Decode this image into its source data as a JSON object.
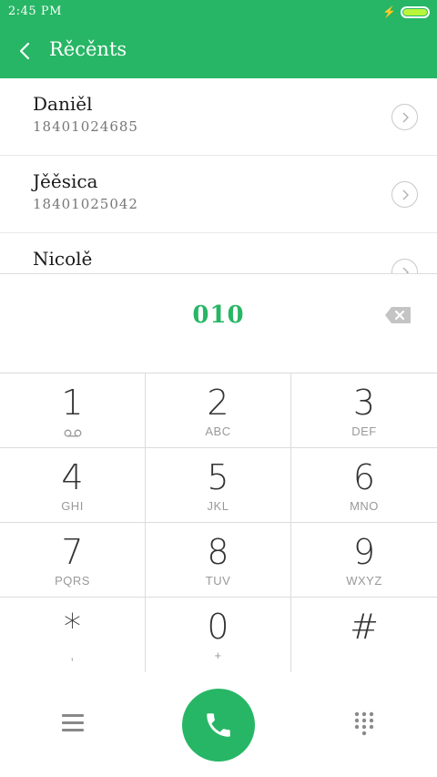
{
  "status": {
    "time": "2:45 PM"
  },
  "app_bar": {
    "title": "Rěcěnts"
  },
  "recents": [
    {
      "name": "Daniěl",
      "number": "18401024685"
    },
    {
      "name": "Jěěsica",
      "number": "18401025042"
    },
    {
      "name": "Nicolě",
      "number": ""
    }
  ],
  "dialer": {
    "input": "010"
  },
  "keypad": [
    {
      "digit": "1",
      "sub": "",
      "sub_icon": "voicemail-icon"
    },
    {
      "digit": "2",
      "sub": "ABC"
    },
    {
      "digit": "3",
      "sub": "DEF"
    },
    {
      "digit": "4",
      "sub": "GHI"
    },
    {
      "digit": "5",
      "sub": "JKL"
    },
    {
      "digit": "6",
      "sub": "MNO"
    },
    {
      "digit": "7",
      "sub": "PQRS"
    },
    {
      "digit": "8",
      "sub": "TUV"
    },
    {
      "digit": "9",
      "sub": "WXYZ"
    },
    {
      "digit": "*",
      "sub": ","
    },
    {
      "digit": "0",
      "sub": "+"
    },
    {
      "digit": "#",
      "sub": ""
    }
  ],
  "colors": {
    "accent": "#27b665",
    "battery": "#b9f53a"
  },
  "icons": {
    "back": "chevron-left-icon",
    "detail": "chevron-right-icon",
    "backspace": "backspace-icon",
    "menu": "menu-icon",
    "call": "phone-icon",
    "dialpad": "dialpad-icon"
  }
}
